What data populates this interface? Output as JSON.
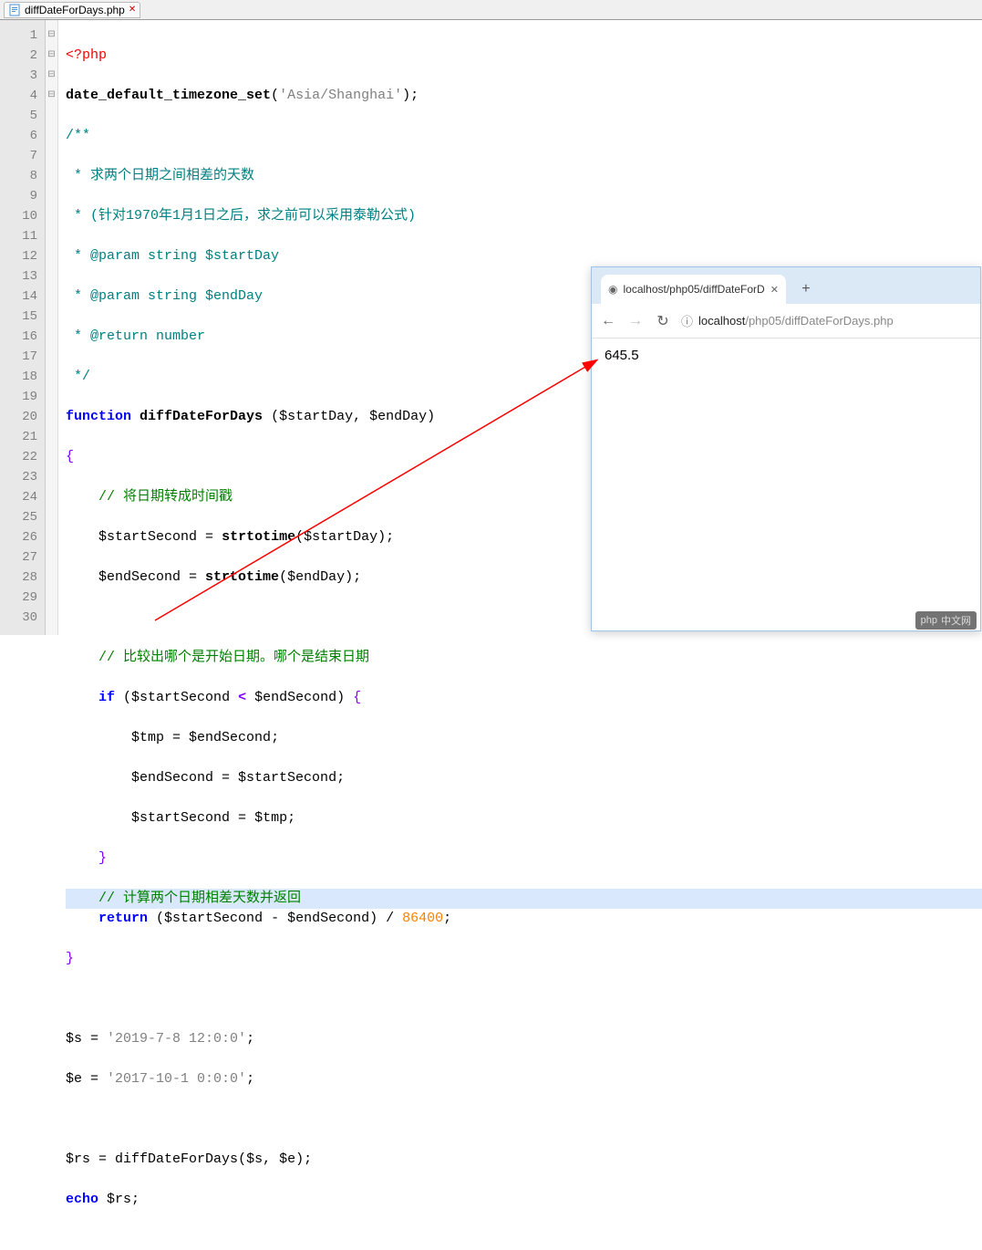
{
  "editor": {
    "tab": {
      "filename": "diffDateForDays.php",
      "close_glyph": "✕"
    },
    "gutter_start": 1,
    "gutter_count": 30,
    "fold_markers": {
      "1": "⊟",
      "3": "⊟",
      "11": "⊟",
      "17": "⊟"
    },
    "code": {
      "l1_open": "<?php",
      "l2_fn": "date_default_timezone_set",
      "l2_str": "'Asia/Shanghai'",
      "l3": "/**",
      "l4": " * 求两个日期之间相差的天数",
      "l5": " * (针对1970年1月1日之后，求之前可以采用泰勒公式)",
      "l6_pre": " * @param string ",
      "l6_var": "$startDay",
      "l7_pre": " * @param string ",
      "l7_var": "$endDay",
      "l8": " * @return number",
      "l9": " */",
      "l10_kw": "function",
      "l10_name": "diffDateForDays",
      "l10_p1": "$startDay",
      "l10_p2": "$endDay",
      "l12": "// 将日期转成时间戳",
      "l13_var": "$startSecond",
      "l13_fn": "strtotime",
      "l13_arg": "$startDay",
      "l14_var": "$endSecond",
      "l14_fn": "strtotime",
      "l14_arg": "$endDay",
      "l16": "// 比较出哪个是开始日期。哪个是结束日期",
      "l17_kw": "if",
      "l17_a": "$startSecond",
      "l17_b": "$endSecond",
      "l18_a": "$tmp",
      "l18_b": "$endSecond",
      "l19_a": "$endSecond",
      "l19_b": "$startSecond",
      "l20_a": "$startSecond",
      "l20_b": "$tmp",
      "l22": "// 计算两个日期相差天数并返回",
      "l23_kw": "return",
      "l23_a": "$startSecond",
      "l23_b": "$endSecond",
      "l23_num": "86400",
      "l26_var": "$s",
      "l26_str": "'2019-7-8 12:0:0'",
      "l27_var": "$e",
      "l27_str": "'2017-10-1 0:0:0'",
      "l29_var": "$rs",
      "l29_fn": "diffDateForDays",
      "l29_a": "$s",
      "l29_b": "$e",
      "l30_kw": "echo",
      "l30_var": "$rs"
    }
  },
  "browser": {
    "tab_title": "localhost/php05/diffDateForD",
    "url_host": "localhost",
    "url_path": "/php05/diffDateForDays.php",
    "output": "645.5",
    "back_glyph": "←",
    "forward_glyph": "→",
    "reload_glyph": "↻",
    "info_glyph": "ⓘ",
    "plus_glyph": "+",
    "close_glyph": "✕",
    "globe_glyph": "◉"
  },
  "watermark": {
    "text": "中文网",
    "prefix": "php"
  }
}
